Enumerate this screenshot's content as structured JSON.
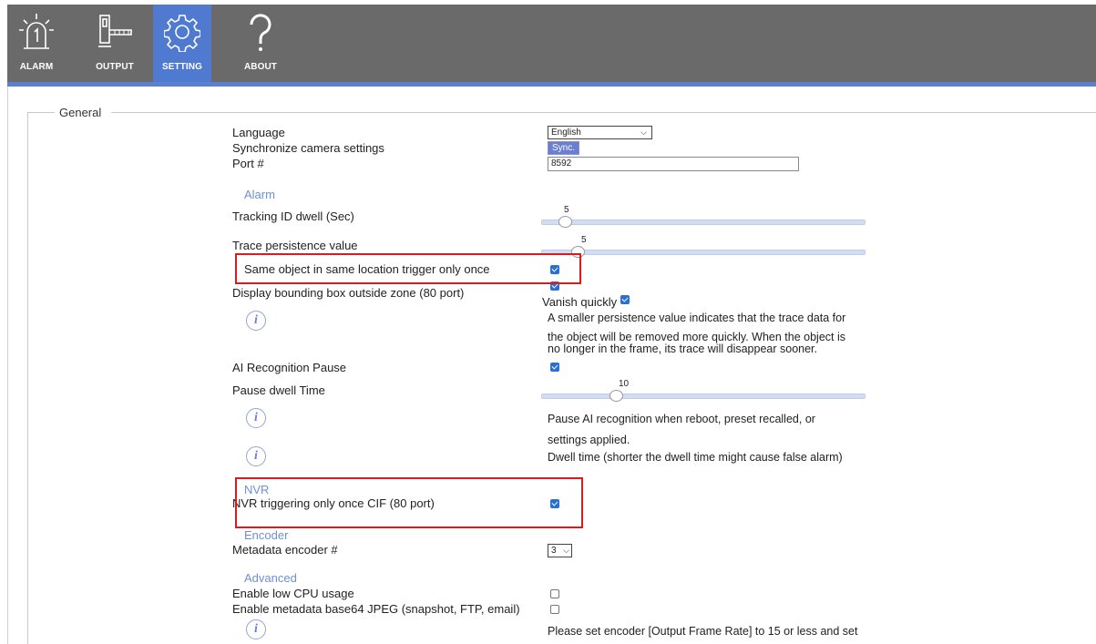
{
  "nav": [
    {
      "label": "ALARM",
      "icon": "alarm-light-icon"
    },
    {
      "label": "OUTPUT",
      "icon": "barrier-gate-icon"
    },
    {
      "label": "SETTING",
      "icon": "gear-icon",
      "active": true
    },
    {
      "label": "ABOUT",
      "icon": "question-icon"
    }
  ],
  "general": {
    "legend": "General",
    "language_label": "Language",
    "language_value": "English",
    "sync_label": "Synchronize camera settings",
    "sync_button": "Sync.",
    "port_label": "Port #",
    "port_value": "8592"
  },
  "alarm": {
    "title": "Alarm",
    "tracking_dwell_label": "Tracking ID dwell (Sec)",
    "tracking_dwell_value": "5",
    "tracking_dwell_fraction": 0.07,
    "trace_persistence_label": "Trace persistence value",
    "trace_persistence_value": "5",
    "trace_persistence_fraction": 0.11,
    "same_object_label": "Same object in same location trigger only once",
    "same_object_checked": true,
    "bbox_label": "Display bounding box outside zone (80 port)",
    "bbox_checked": true,
    "vanish_label": "Vanish quickly",
    "vanish_checked": true,
    "persistence_info": [
      "A smaller persistence value indicates that the trace data for",
      "the object will be removed more quickly. When the object is",
      "no longer in the frame, its trace will disappear sooner."
    ],
    "ai_pause_label": "AI Recognition Pause",
    "ai_pause_checked": true,
    "pause_dwell_label": "Pause dwell Time",
    "pause_dwell_value": "10",
    "pause_dwell_fraction": 0.23,
    "pause_info": [
      "Pause AI recognition when reboot, preset recalled, or",
      "settings applied."
    ],
    "dwell_info": "Dwell time (shorter the dwell time might cause false alarm)"
  },
  "nvr": {
    "title": "NVR",
    "trigger_label": "NVR triggering only once CIF (80 port)",
    "trigger_checked": true
  },
  "encoder": {
    "title": "Encoder",
    "metadata_label": "Metadata encoder #",
    "metadata_value": "3"
  },
  "advanced": {
    "title": "Advanced",
    "low_cpu_label": "Enable low CPU usage",
    "low_cpu_checked": false,
    "base64_label": "Enable metadata base64 JPEG (snapshot, FTP, email)",
    "base64_checked": false,
    "info": "Please set encoder [Output Frame Rate] to 15 or less and set"
  },
  "colors": {
    "accent": "#5b80d3",
    "topbar": "#6a6a6a",
    "highlight": "#dc1c1c",
    "section": "#6f8fd5"
  }
}
